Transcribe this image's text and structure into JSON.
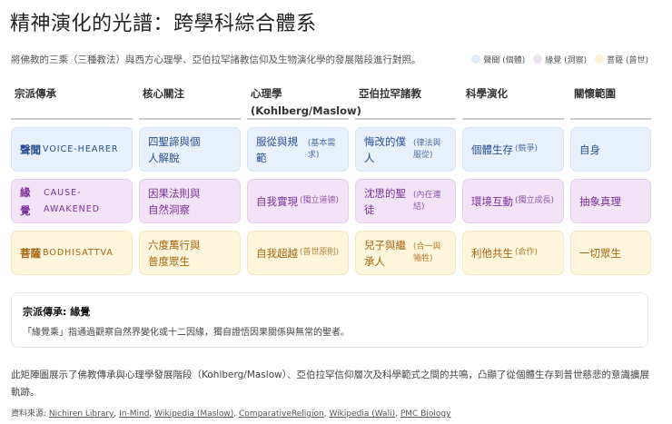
{
  "title": "精神演化的光譜：跨學科綜合體系",
  "subtitle": "將佛教的三乘（三種教法）與西方心理學、亞伯拉罕諸教信仰及生物演化學的發展階段進行對照。",
  "legend": [
    {
      "label": "聲聞 (個體)",
      "color": "#e3ebf9"
    },
    {
      "label": "緣覺 (洞察)",
      "color": "#ede1f1"
    },
    {
      "label": "菩薩 (普世)",
      "color": "#fbf1d3"
    }
  ],
  "headers": [
    "宗派傳承",
    "核心關注",
    "心理學\n(Kohlberg/Maslow)",
    "亞伯拉罕諸教",
    "科學演化",
    "關懷範圍"
  ],
  "rows": [
    {
      "school": "聲聞",
      "school_en": "VOICE-HEARER",
      "focus": "四聖諦與個人解脫",
      "psych": "服從與規範",
      "psych_note": "(基本需求)",
      "abraham": "悔改的僕人",
      "abraham_note": "(律法與服從)",
      "science": "個體生存",
      "science_note": "(競爭)",
      "scope": "自身"
    },
    {
      "school": "緣覺",
      "school_en": "CAUSE-AWAKENED",
      "focus": "因果法則與自然洞察",
      "psych": "自我實現",
      "psych_note": "(獨立道德)",
      "abraham": "沈思的聖徒",
      "abraham_note": "(內在連結)",
      "science": "環境互動",
      "science_note": "(獨立成長)",
      "scope": "抽象真理"
    },
    {
      "school": "菩薩",
      "school_en": "BODHISATTVA",
      "focus": "六度萬行與普度眾生",
      "psych": "自我超越",
      "psych_note": "(普世原則)",
      "abraham": "兒子與繼承人",
      "abraham_note": "(合一與犧牲)",
      "science": "利他共生",
      "science_note": "(合作)",
      "scope": "一切眾生"
    }
  ],
  "detail": {
    "title": "宗派傳承: 緣覺",
    "text": "「緣覺乘」指通過觀察自然界變化或十二因緣，獨自證悟因果關係與無常的聖者。"
  },
  "summary": "此矩陣圖展示了佛教傳承與心理學發展階段（Kohlberg/Maslow）、亞伯拉罕信仰層次及科學範式之間的共鳴，凸顯了從個體生存到普世慈悲的意識擴展軌跡。",
  "sources_label": "資料來源:",
  "sources": [
    "Nichiren Library",
    "In-Mind",
    "Wikipedia (Maslow)",
    "ComparativeReligion",
    "Wikipedia (Wali)",
    "PMC Biology"
  ]
}
